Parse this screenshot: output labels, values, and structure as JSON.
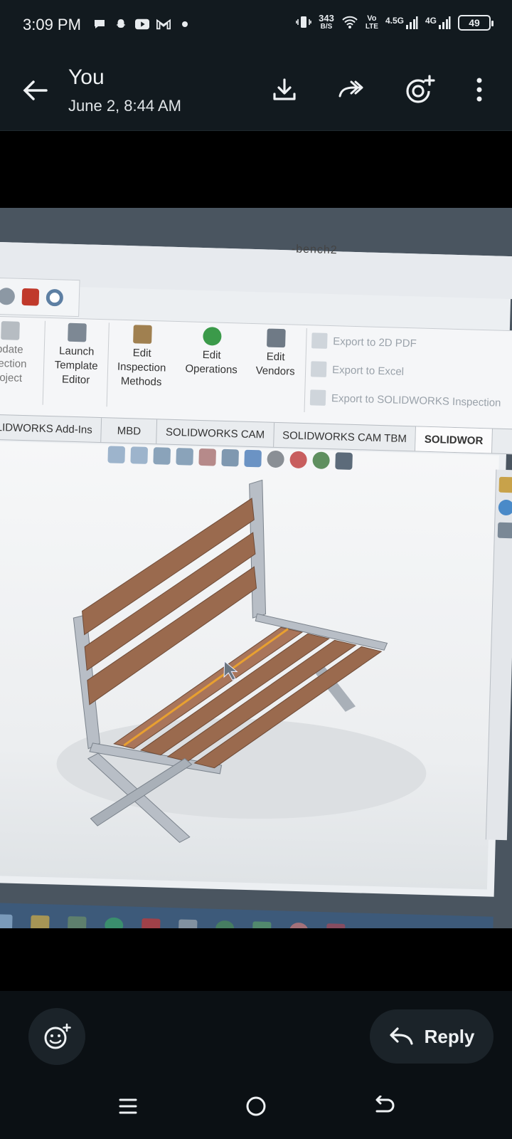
{
  "status_bar": {
    "time": "3:09 PM",
    "left_icons": [
      "chat-bubble-icon",
      "snapchat-icon",
      "youtube-icon",
      "gmail-icon",
      "dot-icon"
    ],
    "net_speed_value": "343",
    "net_speed_unit": "B/S",
    "volte_top": "Vo",
    "volte_bottom": "LTE",
    "signal_1_label": "4.5G",
    "signal_2_label": "4G",
    "battery": "49"
  },
  "app_bar": {
    "sender": "You",
    "timestamp": "June 2, 8:44 AM",
    "actions": [
      "download-icon",
      "forward-icon",
      "add-status-icon",
      "more-vert-icon"
    ]
  },
  "screenshot": {
    "title_fragment": "-bench2",
    "ribbon": {
      "update_project": [
        "pdate",
        "pection",
        "roject"
      ],
      "launch_template_editor": [
        "Launch",
        "Template",
        "Editor"
      ],
      "edit_inspection_methods": [
        "Edit",
        "Inspection",
        "Methods"
      ],
      "edit_operations": [
        "Edit",
        "Operations"
      ],
      "edit_vendors": [
        "Edit",
        "Vendors"
      ],
      "export_2d_pdf": "Export to 2D PDF",
      "export_excel": "Export to Excel",
      "export_solidworks_inspection": "Export to SOLIDWORKS Inspection"
    },
    "tabs": [
      "LIDWORKS Add-Ins",
      "MBD",
      "SOLIDWORKS CAM",
      "SOLIDWORKS CAM TBM",
      "SOLIDWOR"
    ],
    "active_tab_index": 4
  },
  "actions": {
    "reply_label": "Reply"
  },
  "colors": {
    "wood": "#9a6a4e",
    "frame": "#b8bec6",
    "highlight": "#e8a030",
    "taskbar": "#3d5a7a"
  }
}
